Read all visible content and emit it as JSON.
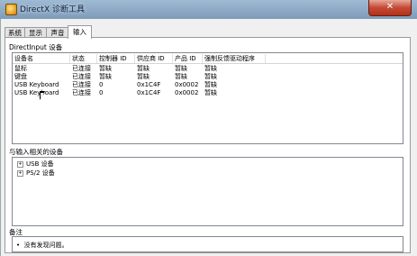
{
  "window": {
    "title": "DirectX 诊断工具",
    "close_glyph": "✕"
  },
  "tabs": [
    {
      "label": "系统",
      "active": false
    },
    {
      "label": "显示",
      "active": false
    },
    {
      "label": "声音",
      "active": false
    },
    {
      "label": "输入",
      "active": true
    }
  ],
  "directinput": {
    "group_title": "DirectInput 设备",
    "columns": [
      "设备名",
      "状态",
      "控制器 ID",
      "供应商 ID",
      "产品 ID",
      "强制反馈驱动程序"
    ],
    "rows": [
      [
        "鼠标",
        "已连接",
        "暂缺",
        "暂缺",
        "暂缺",
        "暂缺"
      ],
      [
        "键盘",
        "已连接",
        "暂缺",
        "暂缺",
        "暂缺",
        "暂缺"
      ],
      [
        "USB Keyboard",
        "已连接",
        "0",
        "0x1C4F",
        "0x0002",
        "暂缺"
      ],
      [
        "USB Keyboard",
        "已连接",
        "0",
        "0x1C4F",
        "0x0002",
        "暂缺"
      ]
    ]
  },
  "related_devices": {
    "group_title": "与输入相关的设备",
    "items": [
      {
        "expander": "+",
        "label": "USB 设备"
      },
      {
        "expander": "+",
        "label": "PS/2 设备"
      }
    ]
  },
  "notes": {
    "group_title": "备注",
    "items": [
      "没有发现问题。"
    ]
  },
  "colors": {
    "titlebar": "#8aa8c6",
    "close_button": "#c44a34"
  }
}
